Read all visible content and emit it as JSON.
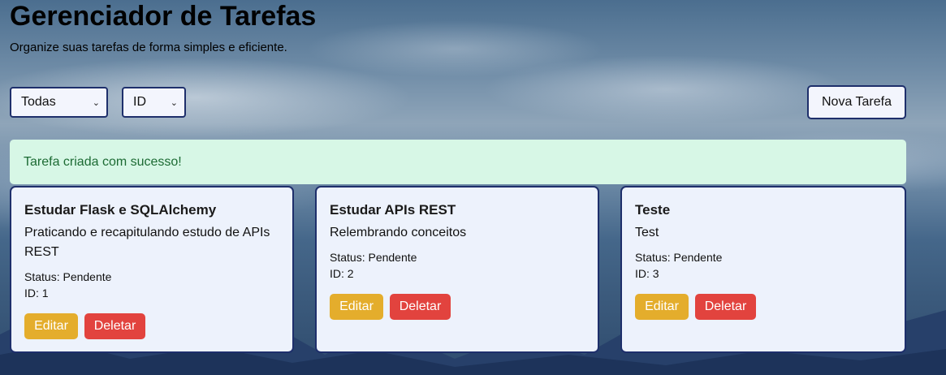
{
  "header": {
    "title": "Gerenciador de Tarefas",
    "subtitle": "Organize suas tarefas de forma simples e eficiente."
  },
  "filters": {
    "status_selected": "Todas",
    "order_selected": "ID"
  },
  "toolbar": {
    "new_task_label": "Nova Tarefa"
  },
  "alert": {
    "message": "Tarefa criada com sucesso!"
  },
  "labels": {
    "status_prefix": "Status:",
    "id_prefix": "ID:",
    "edit": "Editar",
    "delete": "Deletar"
  },
  "tasks": [
    {
      "title": "Estudar Flask e SQLAlchemy",
      "description": "Praticando e recapitulando estudo de APIs REST",
      "status": "Pendente",
      "id": "1"
    },
    {
      "title": "Estudar APIs REST",
      "description": "Relembrando conceitos",
      "status": "Pendente",
      "id": "2"
    },
    {
      "title": "Teste",
      "description": "Test",
      "status": "Pendente",
      "id": "3"
    }
  ],
  "colors": {
    "border": "#1e2f6b",
    "card_bg": "#edf2fc",
    "edit": "#e4ad2c",
    "delete": "#e2433e",
    "alert_bg": "#d7f7e6",
    "alert_text": "#1d6b34"
  }
}
